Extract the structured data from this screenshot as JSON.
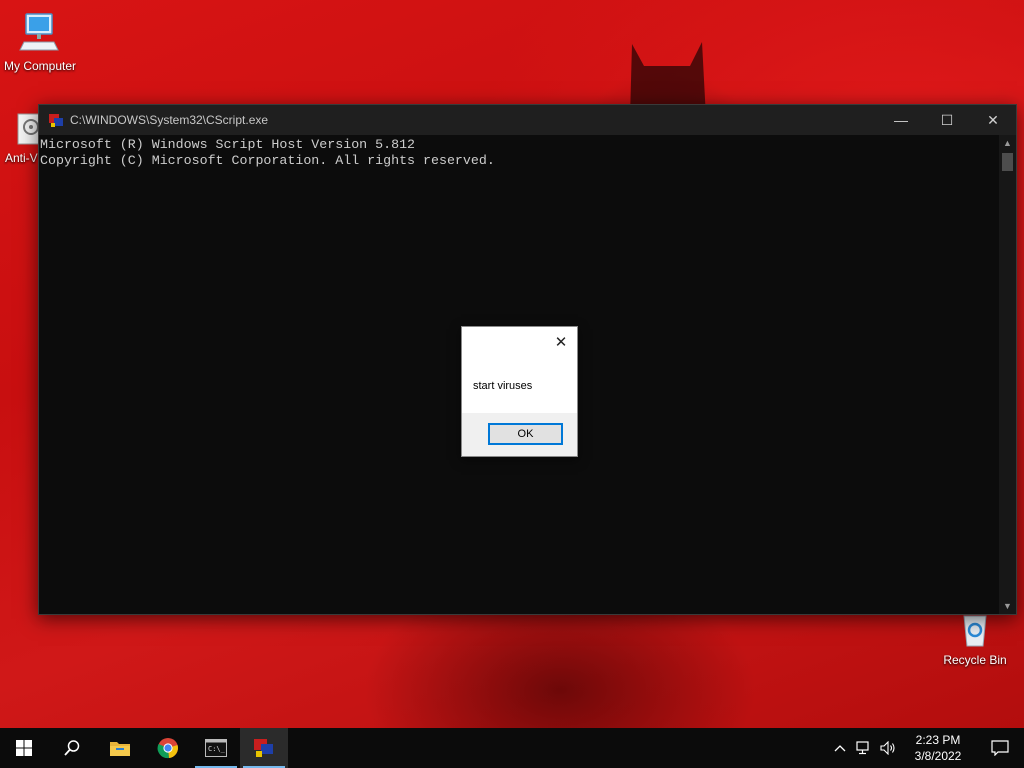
{
  "desktop": {
    "icons": [
      {
        "label": "My Computer",
        "icon": "computer-icon"
      },
      {
        "label": "Anti-V",
        "icon": "anti-virus-icon"
      },
      {
        "label": "Recycle Bin",
        "icon": "recycle-bin-icon"
      }
    ]
  },
  "console": {
    "title": "C:\\WINDOWS\\System32\\CScript.exe",
    "lines": [
      "Microsoft (R) Windows Script Host Version 5.812",
      "Copyright (C) Microsoft Corporation. All rights reserved."
    ],
    "controls": {
      "minimize": "—",
      "maximize": "☐",
      "close": "✕"
    }
  },
  "dialog": {
    "message": "start viruses",
    "ok_label": "OK",
    "close_glyph": "✕"
  },
  "taskbar": {
    "apps": [
      {
        "name": "start",
        "icon": "windows-start-icon"
      },
      {
        "name": "search",
        "icon": "search-icon"
      },
      {
        "name": "file-explorer",
        "icon": "folder-icon"
      },
      {
        "name": "chrome",
        "icon": "chrome-icon"
      },
      {
        "name": "command-prompt",
        "icon": "cmd-icon"
      },
      {
        "name": "cscript",
        "icon": "script-host-icon"
      }
    ],
    "clock": {
      "time": "2:23 PM",
      "date": "3/8/2022"
    }
  },
  "colors": {
    "accent": "#0078d7",
    "wallpaper": "#d01414",
    "console_bg": "#0c0c0c",
    "taskbar_bg": "#0b0b0b"
  }
}
